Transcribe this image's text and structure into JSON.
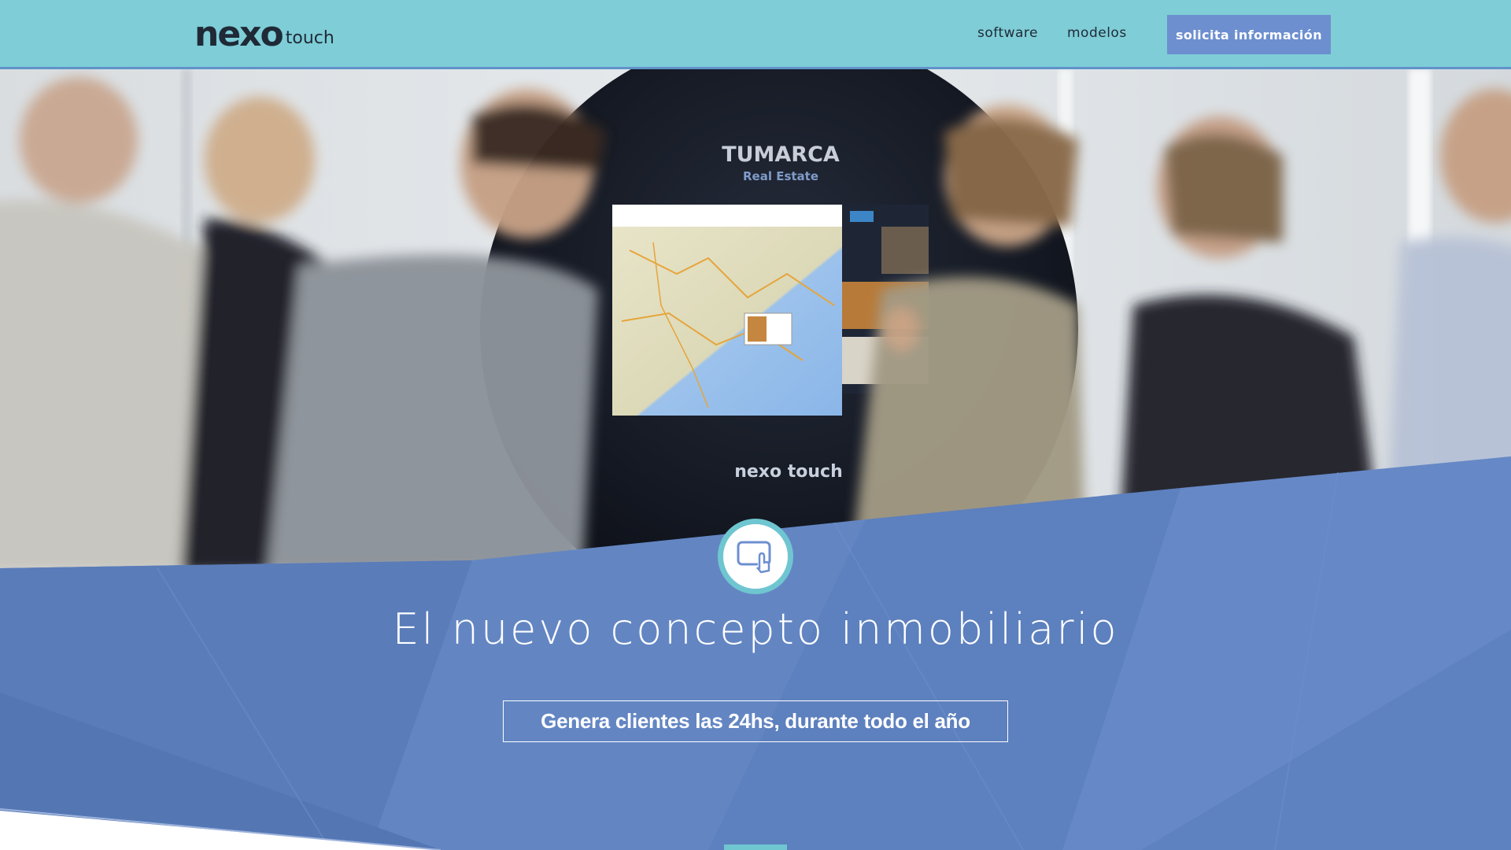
{
  "header": {
    "logo_main": "nexo",
    "logo_sub": "touch",
    "nav": [
      {
        "label": "software"
      },
      {
        "label": "modelos"
      }
    ],
    "cta_label": "solicita información"
  },
  "hero": {
    "kiosk_brand_top": "TUMARCA",
    "kiosk_brand_sub": "Real Estate",
    "kiosk_logo": "nexo touch",
    "icon": "touch-screen-icon",
    "headline": "El nuevo concepto inmobiliario",
    "tagline": "Genera clientes las 24hs, durante todo el año"
  },
  "colors": {
    "header_bg": "#7ecdd7",
    "cta_bg": "#6d8fd0",
    "band_bg": "#5f82c0",
    "accent_teal": "#6fc6d0"
  }
}
